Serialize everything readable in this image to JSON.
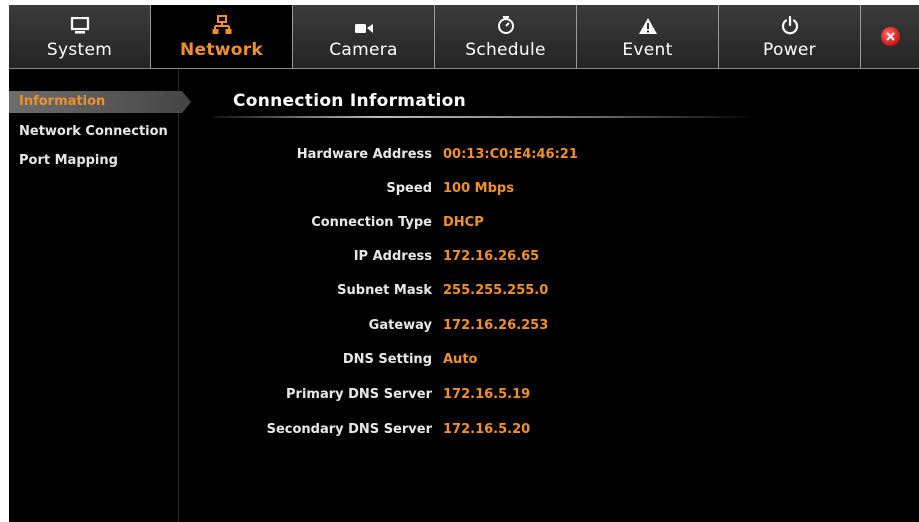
{
  "tabs": [
    {
      "label": "System",
      "icon": "monitor-icon",
      "active": false
    },
    {
      "label": "Network",
      "icon": "network-icon",
      "active": true
    },
    {
      "label": "Camera",
      "icon": "camera-icon",
      "active": false
    },
    {
      "label": "Schedule",
      "icon": "clock-icon",
      "active": false
    },
    {
      "label": "Event",
      "icon": "warning-icon",
      "active": false
    },
    {
      "label": "Power",
      "icon": "power-icon",
      "active": false
    }
  ],
  "sidebar": {
    "items": [
      {
        "label": "Information",
        "active": true
      },
      {
        "label": "Network Connection",
        "active": false
      },
      {
        "label": "Port Mapping",
        "active": false
      }
    ]
  },
  "section": {
    "title": "Connection Information"
  },
  "info": [
    {
      "key": "Hardware Address",
      "value": "00:13:C0:E4:46:21"
    },
    {
      "key": "Speed",
      "value": "100 Mbps"
    },
    {
      "key": "Connection Type",
      "value": "DHCP"
    },
    {
      "key": "IP Address",
      "value": "172.16.26.65"
    },
    {
      "key": "Subnet Mask",
      "value": "255.255.255.0"
    },
    {
      "key": "Gateway",
      "value": "172.16.26.253"
    },
    {
      "key": "DNS Setting",
      "value": "Auto"
    },
    {
      "key": "Primary DNS Server",
      "value": "172.16.5.19"
    },
    {
      "key": "Secondary DNS Server",
      "value": "172.16.5.20"
    }
  ],
  "colors": {
    "accent": "#f0902a",
    "close": "#d01414"
  }
}
